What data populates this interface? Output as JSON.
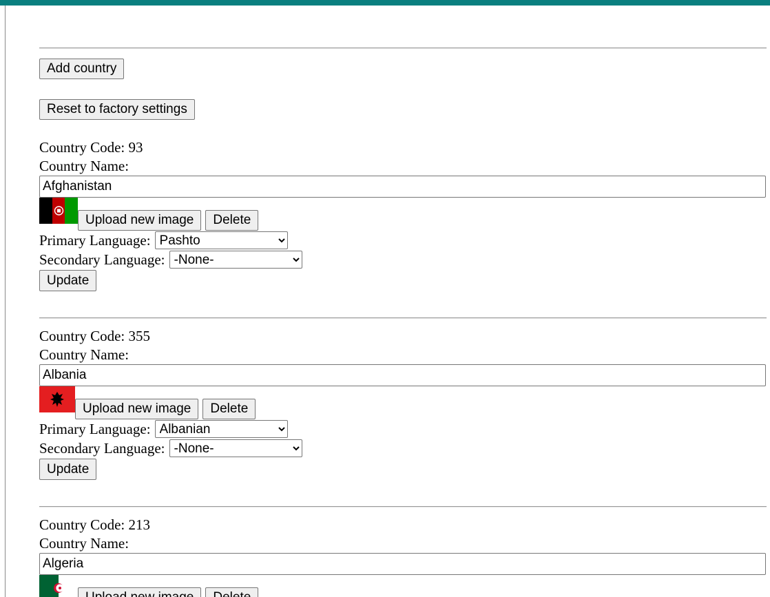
{
  "header": {
    "accent_color": "#0a7f7f"
  },
  "actions": {
    "add_country_label": "Add country",
    "reset_label": "Reset to factory settings"
  },
  "labels": {
    "country_code": "Country Code: ",
    "country_name": "Country Name:",
    "primary_language": "Primary Language:",
    "secondary_language": "Secondary Language:",
    "upload_image": "Upload new image",
    "delete": "Delete",
    "update": "Update"
  },
  "countries": [
    {
      "code": "93",
      "name": "Afghanistan",
      "flag_icon": "afghanistan-flag",
      "primary_language": "Pashto",
      "secondary_language": "-None-"
    },
    {
      "code": "355",
      "name": "Albania",
      "flag_icon": "albania-flag",
      "primary_language": "Albanian",
      "secondary_language": "-None-"
    },
    {
      "code": "213",
      "name": "Algeria",
      "flag_icon": "algeria-flag",
      "primary_language": "",
      "secondary_language": ""
    }
  ]
}
